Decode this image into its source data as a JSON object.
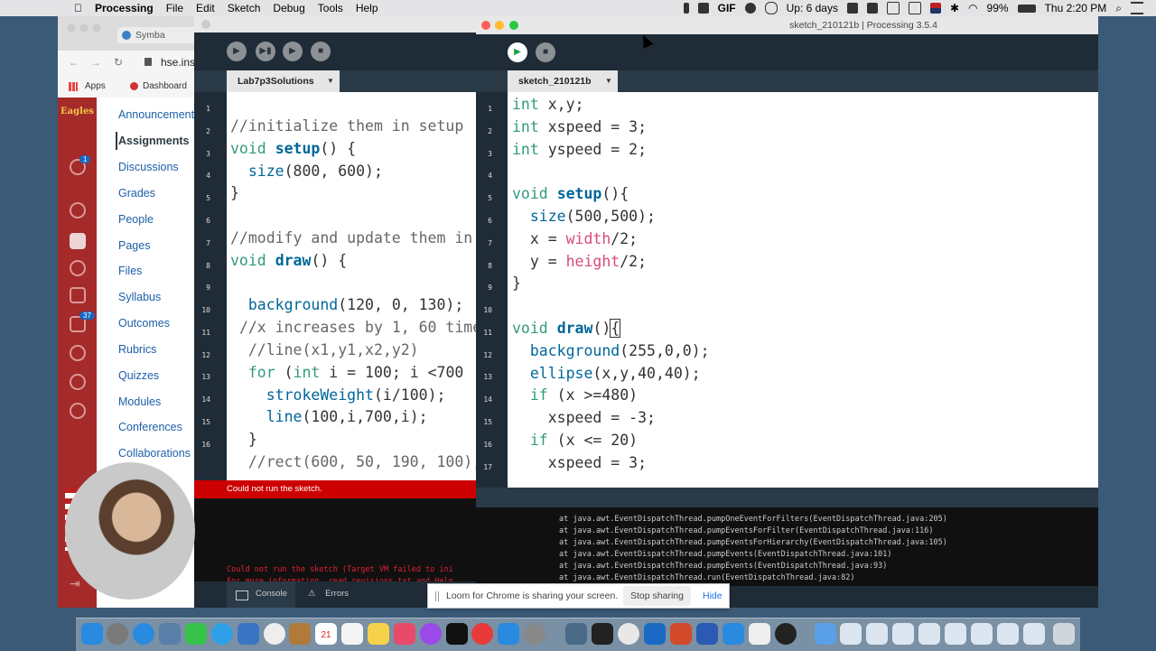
{
  "menubar": {
    "app_name": "Processing",
    "menus": [
      "File",
      "Edit",
      "Sketch",
      "Debug",
      "Tools",
      "Help"
    ],
    "gif_label": "GIF",
    "uptime": "Up: 6 days",
    "battery": "99%",
    "clock": "Thu 2:20 PM"
  },
  "browser": {
    "tab_label": "Symba",
    "url": "hse.ins",
    "bookmarks": [
      "Apps",
      "Dashboard"
    ],
    "canvas_logo": "Eagles",
    "nav_badges": [
      "1",
      "37"
    ],
    "course_nav": [
      "Announcements",
      "Assignments",
      "Discussions",
      "Grades",
      "People",
      "Pages",
      "Files",
      "Syllabus",
      "Outcomes",
      "Rubrics",
      "Quizzes",
      "Modules",
      "Conferences",
      "Collaborations"
    ],
    "course_nav_active": "Assignments"
  },
  "left_window": {
    "tab_label": "Lab7p3Solutions",
    "error_bar": "Could not run the sketch.",
    "console_lines": [
      "Could not run the sketch (Target VM failed to ini",
      "For more information, read revisions.txt and Help"
    ],
    "footer_console": "Console",
    "footer_errors": "Errors"
  },
  "right_window": {
    "title": "sketch_210121b | Processing 3.5.4",
    "tab_label": "sketch_210121b",
    "console_lines": [
      "at java.awt.EventDispatchThread.pumpOneEventForFilters(EventDispatchThread.java:205)",
      "at java.awt.EventDispatchThread.pumpEventsForFilter(EventDispatchThread.java:116)",
      "at java.awt.EventDispatchThread.pumpEventsForHierarchy(EventDispatchThread.java:105)",
      "at java.awt.EventDispatchThread.pumpEvents(EventDispatchThread.java:101)",
      "at java.awt.EventDispatchThread.pumpEvents(EventDispatchThread.java:93)",
      "at java.awt.EventDispatchThread.run(EventDispatchThread.java:82)"
    ]
  },
  "loom": {
    "message": "Loom for Chrome is sharing your screen.",
    "stop_label": "Stop sharing",
    "hide_label": "Hide"
  }
}
